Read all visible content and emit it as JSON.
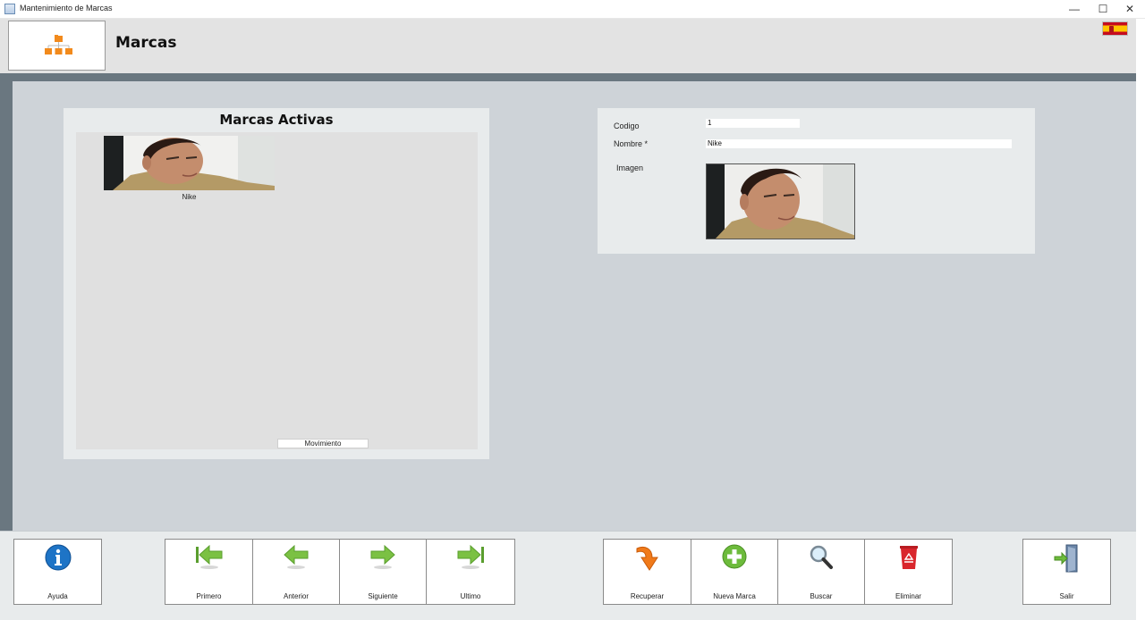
{
  "window": {
    "title": "Mantenimiento de Marcas",
    "minimize": "—",
    "maximize": "☐",
    "close": "✕"
  },
  "header": {
    "title": "Marcas",
    "logo_icon": "hierarchy-folders-icon",
    "language_flag_icon": "spain-flag-icon"
  },
  "left_panel": {
    "title": "Marcas Activas",
    "items": [
      {
        "name": "Nike"
      }
    ],
    "movimiento_label": "Movimiento"
  },
  "right_panel": {
    "codigo_label": "Codigo",
    "codigo_value": "1",
    "nombre_label": "Nombre *",
    "nombre_value": "Nike",
    "imagen_label": "Imagen"
  },
  "toolbar": {
    "ayuda": {
      "label": "Ayuda",
      "icon": "info-icon"
    },
    "navigation": [
      {
        "label": "Primero",
        "icon": "arrow-first-icon"
      },
      {
        "label": "Anterior",
        "icon": "arrow-left-icon"
      },
      {
        "label": "Siguiente",
        "icon": "arrow-right-icon"
      },
      {
        "label": "Ultimo",
        "icon": "arrow-last-icon"
      }
    ],
    "actions": [
      {
        "label": "Recuperar",
        "icon": "curved-arrow-down-icon"
      },
      {
        "label": "Nueva Marca",
        "icon": "plus-circle-icon"
      },
      {
        "label": "Buscar",
        "icon": "magnifier-icon"
      },
      {
        "label": "Eliminar",
        "icon": "recycle-bin-icon"
      }
    ],
    "salir": {
      "label": "Salir",
      "icon": "exit-door-icon"
    }
  },
  "colors": {
    "main_background": "#ced3d8",
    "panel_background": "#e8ebec",
    "band": "#6a7780",
    "nav_arrow": "#7bc143",
    "info_blue": "#1e74c6",
    "recuperar_orange": "#f07a1a",
    "eliminar_red": "#d9262c"
  }
}
